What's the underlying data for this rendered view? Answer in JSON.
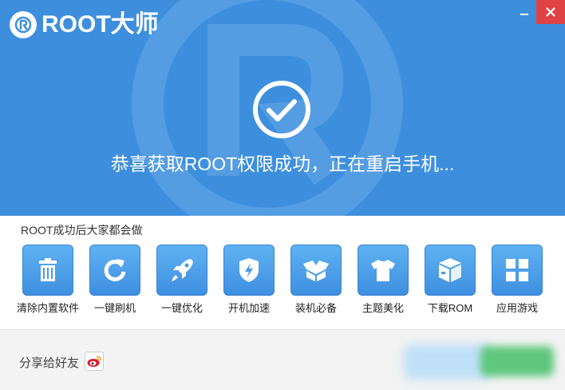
{
  "header": {
    "logo_text": "ROOT大师",
    "minimize_icon": "minimize-icon",
    "close_icon": "close-icon",
    "close_color": "#e04343"
  },
  "hero": {
    "background": "#3d8fde",
    "status_icon": "check-circle-icon",
    "message": "恭喜获取ROOT权限成功，正在重启手机..."
  },
  "apps_section": {
    "title": "ROOT成功后大家都会做",
    "items": [
      {
        "label": "清除内置软件",
        "icon": "trash-icon"
      },
      {
        "label": "一键刷机",
        "icon": "refresh-icon"
      },
      {
        "label": "一键优化",
        "icon": "rocket-icon"
      },
      {
        "label": "开机加速",
        "icon": "shield-bolt-icon"
      },
      {
        "label": "装机必备",
        "icon": "open-box-icon"
      },
      {
        "label": "主题美化",
        "icon": "tshirt-icon"
      },
      {
        "label": "下载ROM",
        "icon": "package-icon"
      },
      {
        "label": "应用游戏",
        "icon": "grid-icon"
      }
    ]
  },
  "footer": {
    "share_label": "分享给好友",
    "weibo_icon": "weibo-icon"
  }
}
